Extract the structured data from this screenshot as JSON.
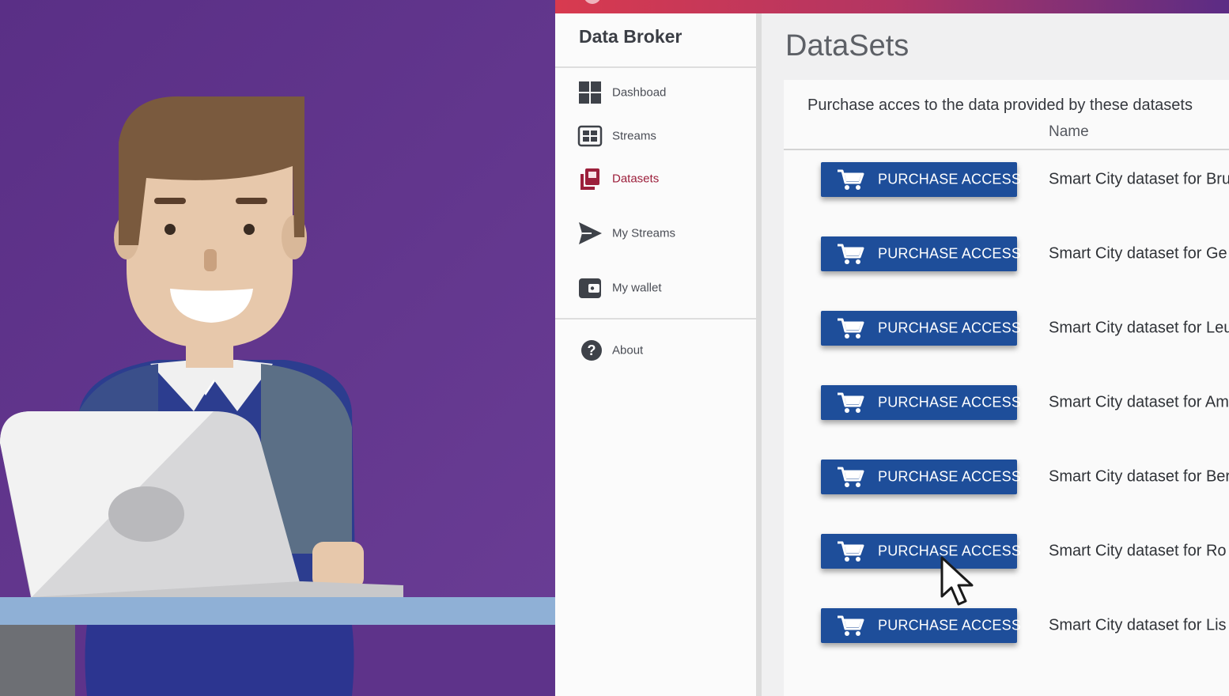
{
  "sidebar": {
    "title": "Data Broker",
    "items": [
      {
        "label": "Dashboad",
        "icon": "dashboard-grid-icon"
      },
      {
        "label": "Streams",
        "icon": "streams-icon"
      },
      {
        "label": "Datasets",
        "icon": "datasets-icon",
        "active": true
      },
      {
        "label": "My Streams",
        "icon": "send-arrow-icon"
      },
      {
        "label": "My wallet",
        "icon": "wallet-icon"
      },
      {
        "label": "About",
        "icon": "help-circle-icon"
      }
    ]
  },
  "main": {
    "title": "DataSets",
    "caption": "Purchase acces to the data provided by these datasets",
    "column_header": "Name",
    "purchase_label": "PURCHASE ACCESS",
    "rows": [
      {
        "name": "Smart City dataset for Bru"
      },
      {
        "name": "Smart City dataset for Ge"
      },
      {
        "name": "Smart City dataset for Leu"
      },
      {
        "name": "Smart City dataset for Am"
      },
      {
        "name": "Smart City dataset for Ber"
      },
      {
        "name": "Smart City dataset for Ro"
      },
      {
        "name": "Smart City dataset for Lis"
      }
    ]
  },
  "colors": {
    "button": "#1e4e9a",
    "active_nav": "#9c1f3b",
    "illustration_bg": "#5e338a",
    "topbar_start": "#d83a4f",
    "topbar_end": "#5b2c85"
  }
}
